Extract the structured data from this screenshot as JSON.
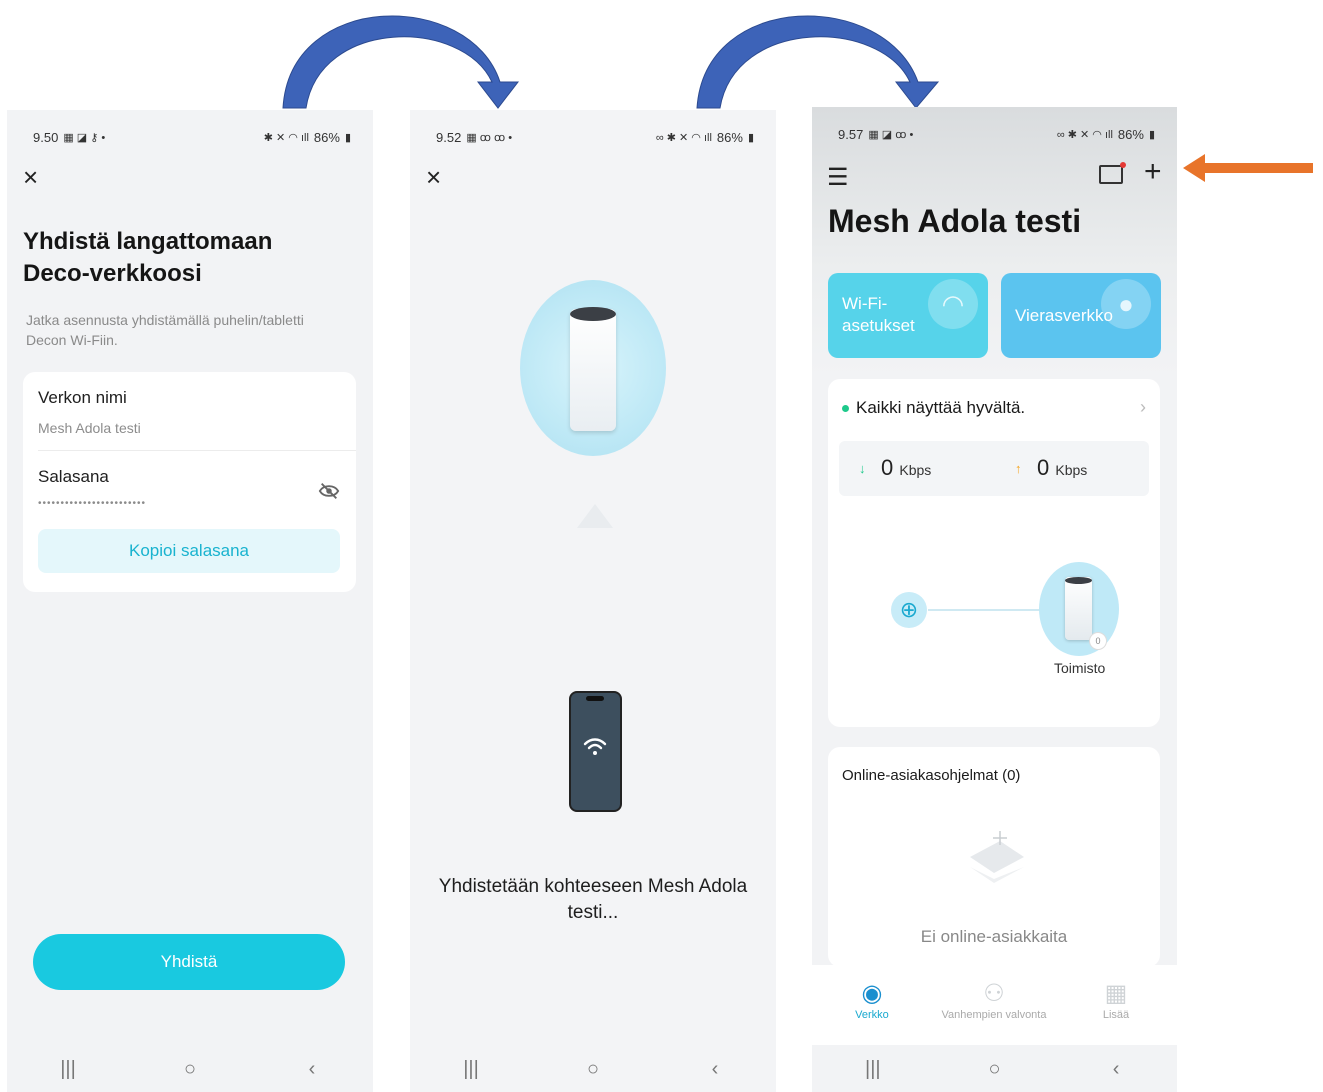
{
  "screen1": {
    "status": {
      "time": "9.50",
      "battery": "86%"
    },
    "title": "Yhdistä langattomaan Deco-verkkoosi",
    "subtitle": "Jatka asennusta yhdistämällä puhelin/tabletti Decon Wi-Fiin.",
    "network_label": "Verkon nimi",
    "network_value": "Mesh Adola testi",
    "password_label": "Salasana",
    "password_value": "••••••••••••••••••••••••",
    "copy_button": "Kopioi salasana",
    "connect_button": "Yhdistä"
  },
  "screen2": {
    "status": {
      "time": "9.52",
      "battery": "86%"
    },
    "connecting_text": "Yhdistetään kohteeseen Mesh Adola testi..."
  },
  "screen3": {
    "status": {
      "time": "9.57",
      "battery": "86%"
    },
    "title": "Mesh Adola testi",
    "tile_wifi": "Wi-Fi-asetukset",
    "tile_guest": "Vierasverkko",
    "status_text": "Kaikki näyttää hyvältä.",
    "download_value": "0",
    "upload_value": "0",
    "speed_unit": "Kbps",
    "node_label": "Toimisto",
    "node_badge": "0",
    "clients_title": "Online-asiakasohjelmat (0)",
    "clients_empty": "Ei online-asiakkaita",
    "tabs": [
      {
        "label": "Verkko",
        "icon": "planet-icon",
        "active": true
      },
      {
        "label": "Vanhempien valvonta",
        "icon": "family-icon",
        "active": false
      },
      {
        "label": "Lisää",
        "icon": "grid-icon",
        "active": false
      }
    ]
  },
  "navbar": {
    "recents": "|||",
    "home": "○",
    "back": "‹"
  },
  "colors": {
    "accent": "#19c9e0",
    "arrow_blue": "#3d63b8",
    "arrow_orange": "#e8742a",
    "ok_green": "#1ec98b"
  }
}
